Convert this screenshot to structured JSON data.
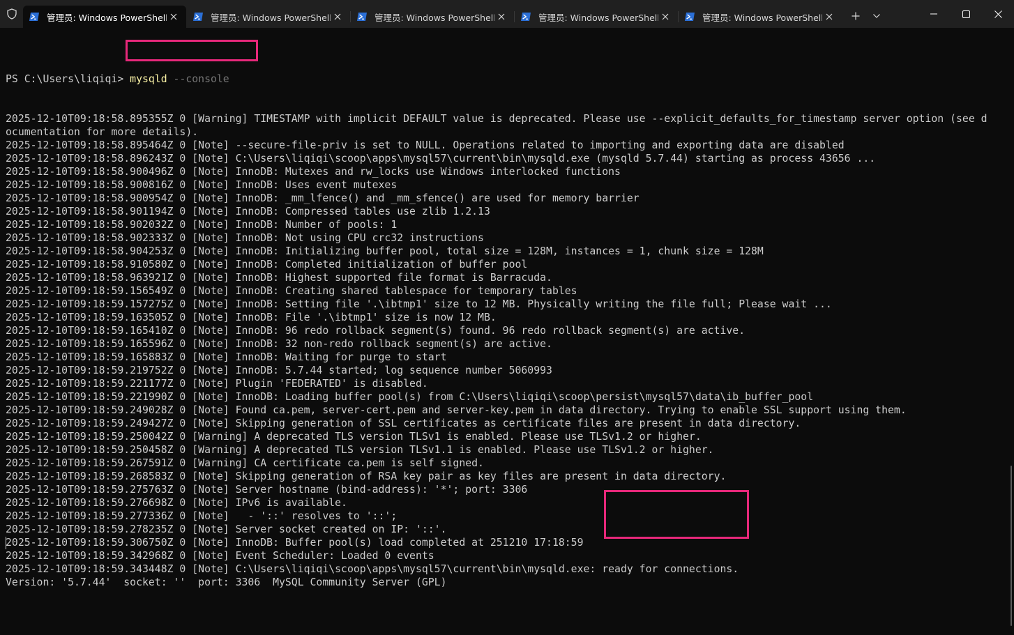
{
  "tabs": [
    {
      "title": "管理员: Windows PowerShell",
      "active": true
    },
    {
      "title": "管理员: Windows PowerShell",
      "active": false
    },
    {
      "title": "管理员: Windows PowerShell",
      "active": false
    },
    {
      "title": "管理员: Windows PowerShell",
      "active": false
    },
    {
      "title": "管理员: Windows PowerShell",
      "active": false
    }
  ],
  "icons": {
    "shield": "shield-icon",
    "tab": "powershell-icon",
    "close": "close-icon",
    "new_tab": "plus-icon",
    "dropdown": "chevron-down-icon",
    "minimize": "minimize-icon",
    "maximize": "maximize-icon",
    "close_window": "close-window-icon"
  },
  "colors": {
    "background": "#0c0c0c",
    "titlebar": "#202020",
    "text": "#cccccc",
    "command": "#f9f1a5",
    "argument": "#767676",
    "highlight": "#e6287a",
    "ps_icon": "#2b6fd6"
  },
  "terminal": {
    "prompt": "PS C:\\Users\\liqiqi> ",
    "command": "mysqld",
    "argument": " --console",
    "lines": [
      "2025-12-10T09:18:58.895355Z 0 [Warning] TIMESTAMP with implicit DEFAULT value is deprecated. Please use --explicit_defaults_for_timestamp server option (see d",
      "ocumentation for more details).",
      "2025-12-10T09:18:58.895464Z 0 [Note] --secure-file-priv is set to NULL. Operations related to importing and exporting data are disabled",
      "2025-12-10T09:18:58.896243Z 0 [Note] C:\\Users\\liqiqi\\scoop\\apps\\mysql57\\current\\bin\\mysqld.exe (mysqld 5.7.44) starting as process 43656 ...",
      "2025-12-10T09:18:58.900496Z 0 [Note] InnoDB: Mutexes and rw_locks use Windows interlocked functions",
      "2025-12-10T09:18:58.900816Z 0 [Note] InnoDB: Uses event mutexes",
      "2025-12-10T09:18:58.900954Z 0 [Note] InnoDB: _mm_lfence() and _mm_sfence() are used for memory barrier",
      "2025-12-10T09:18:58.901194Z 0 [Note] InnoDB: Compressed tables use zlib 1.2.13",
      "2025-12-10T09:18:58.902032Z 0 [Note] InnoDB: Number of pools: 1",
      "2025-12-10T09:18:58.902333Z 0 [Note] InnoDB: Not using CPU crc32 instructions",
      "2025-12-10T09:18:58.904253Z 0 [Note] InnoDB: Initializing buffer pool, total size = 128M, instances = 1, chunk size = 128M",
      "2025-12-10T09:18:58.910580Z 0 [Note] InnoDB: Completed initialization of buffer pool",
      "2025-12-10T09:18:58.963921Z 0 [Note] InnoDB: Highest supported file format is Barracuda.",
      "2025-12-10T09:18:59.156549Z 0 [Note] InnoDB: Creating shared tablespace for temporary tables",
      "2025-12-10T09:18:59.157275Z 0 [Note] InnoDB: Setting file '.\\ibtmp1' size to 12 MB. Physically writing the file full; Please wait ...",
      "2025-12-10T09:18:59.163505Z 0 [Note] InnoDB: File '.\\ibtmp1' size is now 12 MB.",
      "2025-12-10T09:18:59.165410Z 0 [Note] InnoDB: 96 redo rollback segment(s) found. 96 redo rollback segment(s) are active.",
      "2025-12-10T09:18:59.165596Z 0 [Note] InnoDB: 32 non-redo rollback segment(s) are active.",
      "2025-12-10T09:18:59.165883Z 0 [Note] InnoDB: Waiting for purge to start",
      "2025-12-10T09:18:59.219752Z 0 [Note] InnoDB: 5.7.44 started; log sequence number 5060993",
      "2025-12-10T09:18:59.221177Z 0 [Note] Plugin 'FEDERATED' is disabled.",
      "2025-12-10T09:18:59.221990Z 0 [Note] InnoDB: Loading buffer pool(s) from C:\\Users\\liqiqi\\scoop\\persist\\mysql57\\data\\ib_buffer_pool",
      "2025-12-10T09:18:59.249028Z 0 [Note] Found ca.pem, server-cert.pem and server-key.pem in data directory. Trying to enable SSL support using them.",
      "2025-12-10T09:18:59.249427Z 0 [Note] Skipping generation of SSL certificates as certificate files are present in data directory.",
      "2025-12-10T09:18:59.250042Z 0 [Warning] A deprecated TLS version TLSv1 is enabled. Please use TLSv1.2 or higher.",
      "2025-12-10T09:18:59.250458Z 0 [Warning] A deprecated TLS version TLSv1.1 is enabled. Please use TLSv1.2 or higher.",
      "2025-12-10T09:18:59.267591Z 0 [Warning] CA certificate ca.pem is self signed.",
      "2025-12-10T09:18:59.268583Z 0 [Note] Skipping generation of RSA key pair as key files are present in data directory.",
      "2025-12-10T09:18:59.275763Z 0 [Note] Server hostname (bind-address): '*'; port: 3306",
      "2025-12-10T09:18:59.276698Z 0 [Note] IPv6 is available.",
      "2025-12-10T09:18:59.277336Z 0 [Note]   - '::' resolves to '::';",
      "2025-12-10T09:18:59.278235Z 0 [Note] Server socket created on IP: '::'.",
      "2025-12-10T09:18:59.306750Z 0 [Note] InnoDB: Buffer pool(s) load completed at 251210 17:18:59",
      "2025-12-10T09:18:59.342968Z 0 [Note] Event Scheduler: Loaded 0 events",
      "2025-12-10T09:18:59.343448Z 0 [Note] C:\\Users\\liqiqi\\scoop\\apps\\mysql57\\current\\bin\\mysqld.exe: ready for connections.",
      "Version: '5.7.44'  socket: ''  port: 3306  MySQL Community Server (GPL)"
    ]
  }
}
